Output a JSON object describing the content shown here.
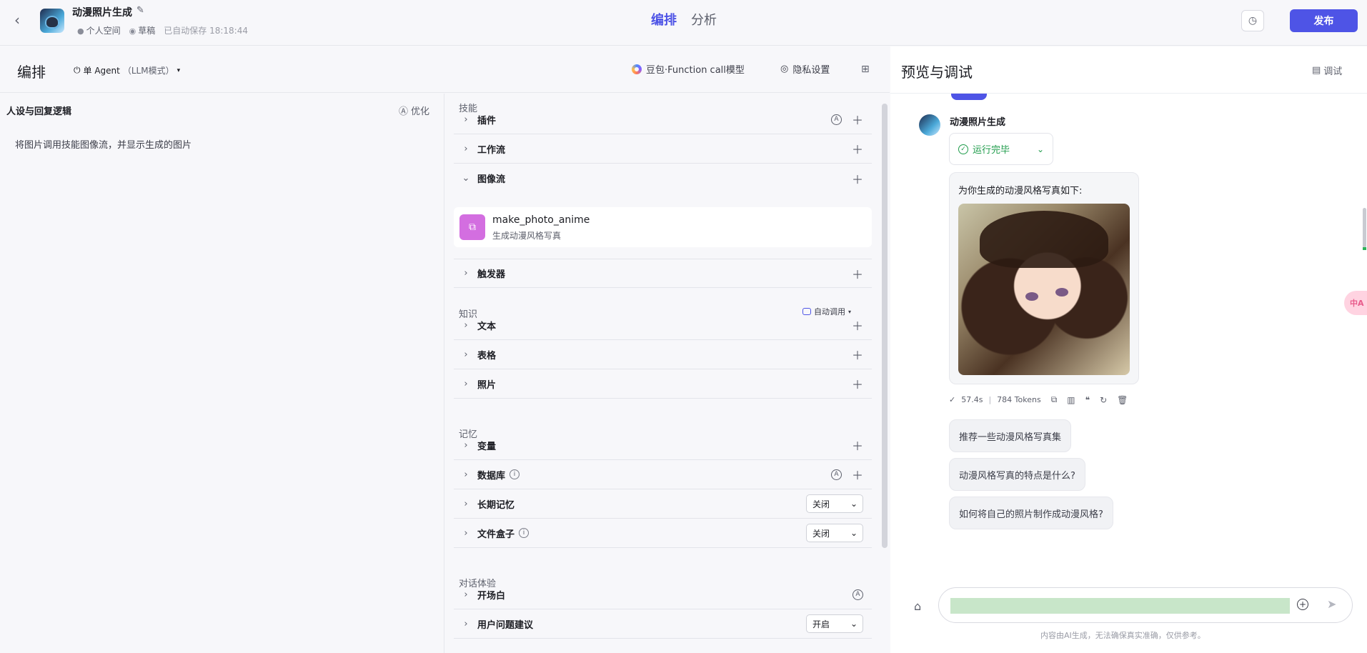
{
  "topbar": {
    "app_title": "动漫照片生成",
    "space": "个人空间",
    "status": "草稿",
    "autosave": "已自动保存 18:18:44",
    "tabs": [
      "编排",
      "分析"
    ],
    "publish_label": "发布"
  },
  "editor": {
    "title": "编排",
    "agent_mode": "单 Agent",
    "agent_mode_sub": "（LLM模式）",
    "model": "豆包·Function call模型",
    "privacy": "隐私设置"
  },
  "persona": {
    "title": "人设与回复逻辑",
    "optimize_label": "优化",
    "content": "将图片调用技能图像流，并显示生成的图片"
  },
  "skills": {
    "section_skills": "技能",
    "plugin": "插件",
    "workflow": "工作流",
    "imageflow": "图像流",
    "imageflow_item_name": "make_photo_anime",
    "imageflow_item_desc": "生成动漫风格写真",
    "trigger": "触发器",
    "section_knowledge": "知识",
    "auto_call": "自动调用",
    "text": "文本",
    "table": "表格",
    "photo": "照片",
    "section_memory": "记忆",
    "variable": "变量",
    "database": "数据库",
    "long_memory": "长期记忆",
    "long_memory_value": "关闭",
    "file_box": "文件盒子",
    "file_box_value": "关闭",
    "section_chat": "对话体验",
    "opening": "开场白",
    "user_suggest": "用户问题建议",
    "user_suggest_value": "开启"
  },
  "preview": {
    "title": "预览与调试",
    "debug_label": "调试",
    "bot_name": "动漫照片生成",
    "run_status": "运行完毕",
    "answer_text": "为你生成的动漫风格写真如下:",
    "time": "57.4s",
    "tokens": "784 Tokens",
    "suggestions": [
      "推荐一些动漫风格写真集",
      "动漫风格写真的特点是什么?",
      "如何将自己的照片制作成动漫风格?"
    ],
    "disclaimer": "内容由AI生成，无法确保真实准确，仅供参考。",
    "float_tool": "中A"
  }
}
